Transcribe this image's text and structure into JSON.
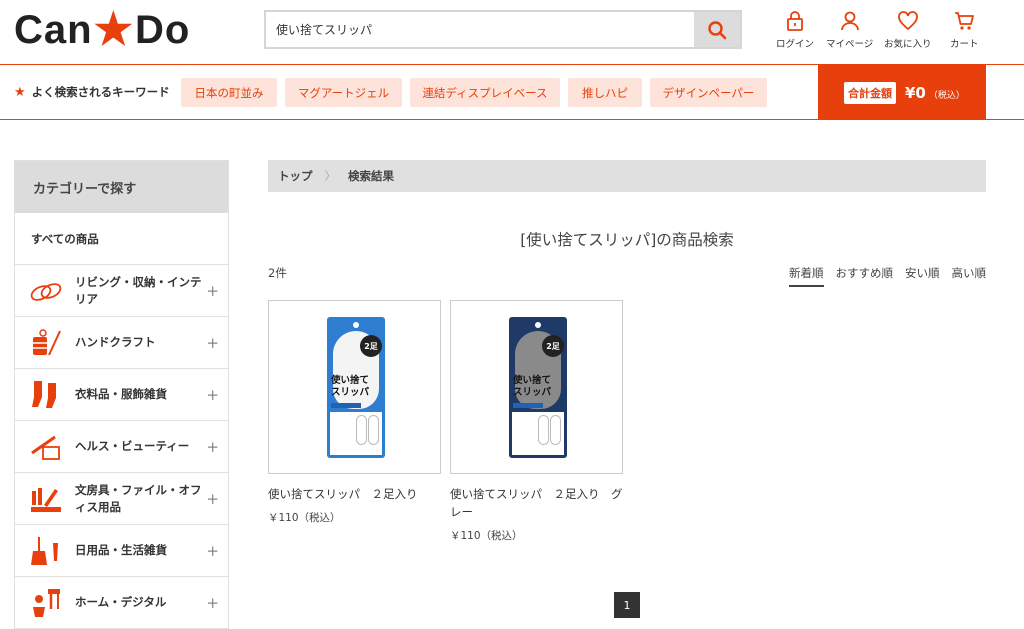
{
  "header": {
    "logo_left": "Can",
    "logo_right": "Do",
    "search": {
      "value": "使い捨てスリッパ",
      "placeholder": ""
    },
    "nav": {
      "login": "ログイン",
      "mypage": "マイページ",
      "favorites": "お気に入り",
      "cart": "カート"
    }
  },
  "keywords": {
    "label": "よく検索されるキーワード",
    "items": [
      "日本の町並み",
      "マグアートジェル",
      "連結ディスプレイベース",
      "推しハピ",
      "デザインペーパー"
    ],
    "total_label": "合計金額",
    "total_value": "¥0",
    "total_tax": "（税込）"
  },
  "sidebar": {
    "title": "カテゴリーで探す",
    "all": "すべての商品",
    "categories": [
      {
        "label": "リビング・収納・インテリア"
      },
      {
        "label": "ハンドクラフト"
      },
      {
        "label": "衣料品・服飾雑貨"
      },
      {
        "label": "ヘルス・ビューティー"
      },
      {
        "label": "文房具・ファイル・オフィス用品"
      },
      {
        "label": "日用品・生活雑貨"
      },
      {
        "label": "ホーム・デジタル"
      }
    ],
    "expand": "+"
  },
  "breadcrumb": {
    "home": "トップ",
    "sep": "〉",
    "current": "検索結果"
  },
  "results": {
    "title": "[使い捨てスリッパ]の商品検索",
    "count": "2件",
    "sorts": [
      "新着順",
      "おすすめ順",
      "安い順",
      "高い順"
    ],
    "products": [
      {
        "name": "使い捨てスリッパ　２足入り",
        "price": "￥110（税込）",
        "pack_text": "使い捨て スリッパ",
        "badge": "2足"
      },
      {
        "name": "使い捨てスリッパ　２足入り　グレー",
        "price": "￥110（税込）",
        "pack_text": "使い捨て スリッパ",
        "badge": "2足"
      }
    ],
    "page": "1"
  },
  "colors": {
    "accent": "#e8400c",
    "chip_bg": "#fde3d9",
    "pack_blue": "#1e63b5"
  }
}
